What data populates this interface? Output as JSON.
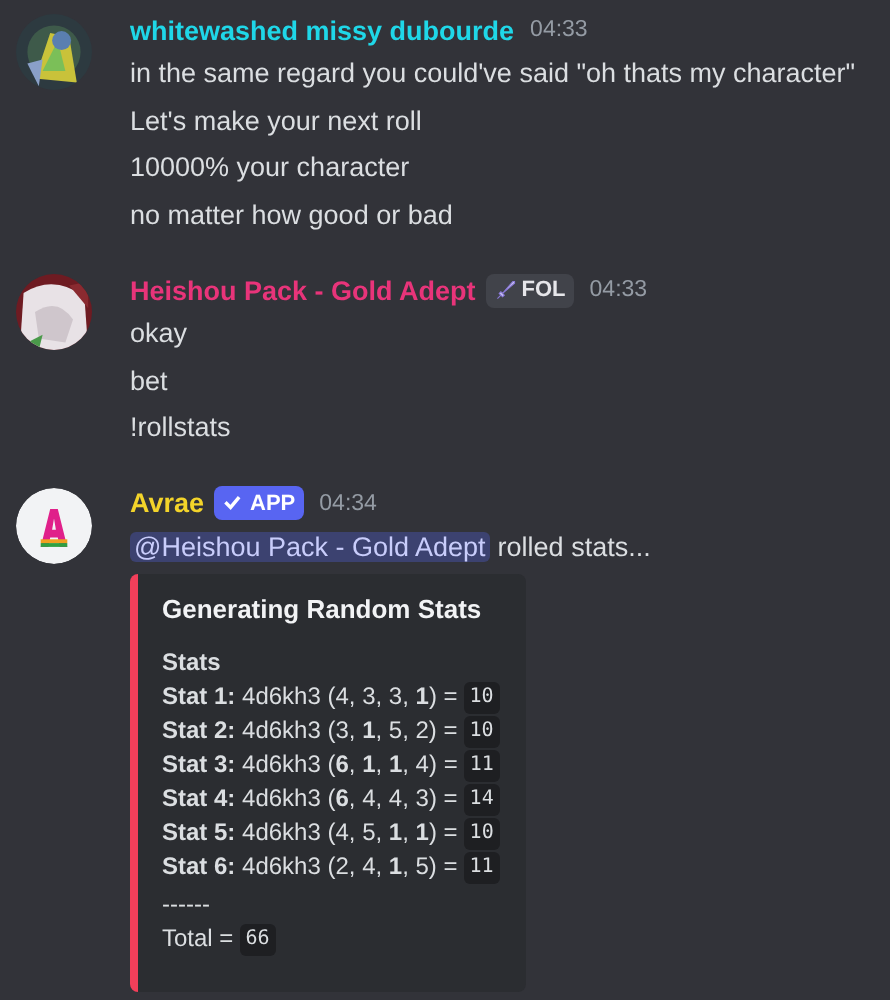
{
  "messages": [
    {
      "author": "whitewashed missy dubourde",
      "color": "#1fd7e8",
      "avatar": {
        "kind": "picture"
      },
      "time": "04:33",
      "lines": [
        "in the same regard you could've said \"oh thats my character\"",
        "Let's make your next roll",
        "10000% your character",
        "no matter how good or bad"
      ]
    },
    {
      "author": "Heishou Pack - Gold Adept",
      "color": "#e8347a",
      "avatar": {
        "kind": "picture"
      },
      "time": "04:33",
      "tag": {
        "kind": "guild",
        "label": "FOL"
      },
      "lines": [
        "okay",
        "bet",
        "!rollstats"
      ]
    },
    {
      "author": "Avrae",
      "color": "#f3d42a",
      "avatar": {
        "kind": "logo"
      },
      "time": "04:34",
      "tag": {
        "kind": "app",
        "label": "APP"
      },
      "mention": "@Heishou Pack - Gold Adept",
      "mention_rest": "rolled stats...",
      "embed": {
        "color": "#f23f5a",
        "title": "Generating Random Stats",
        "heading": "Stats",
        "stats": [
          {
            "text": "**Stat 1:** 4d6kh3 (4, 3, 3, **1**) =",
            "total": "10"
          },
          {
            "text": "**Stat 2:** 4d6kh3 (3, **1**, 5, 2) =",
            "total": "10"
          },
          {
            "text": "**Stat 3:** 4d6kh3 (**6**, **1**, **1**, 4) =",
            "total": "11"
          },
          {
            "text": "**Stat 4:** 4d6kh3 (**6**, 4, 4, 3) =",
            "total": "14"
          },
          {
            "text": "**Stat 5:** 4d6kh3 (4, 5, **1**, **1**) =",
            "total": "10"
          },
          {
            "text": "**Stat 6:** 4d6kh3 (2, 4, **1**, 5) =",
            "total": "11"
          }
        ],
        "separator": "------",
        "total_label": "Total =",
        "total": "66"
      }
    }
  ]
}
